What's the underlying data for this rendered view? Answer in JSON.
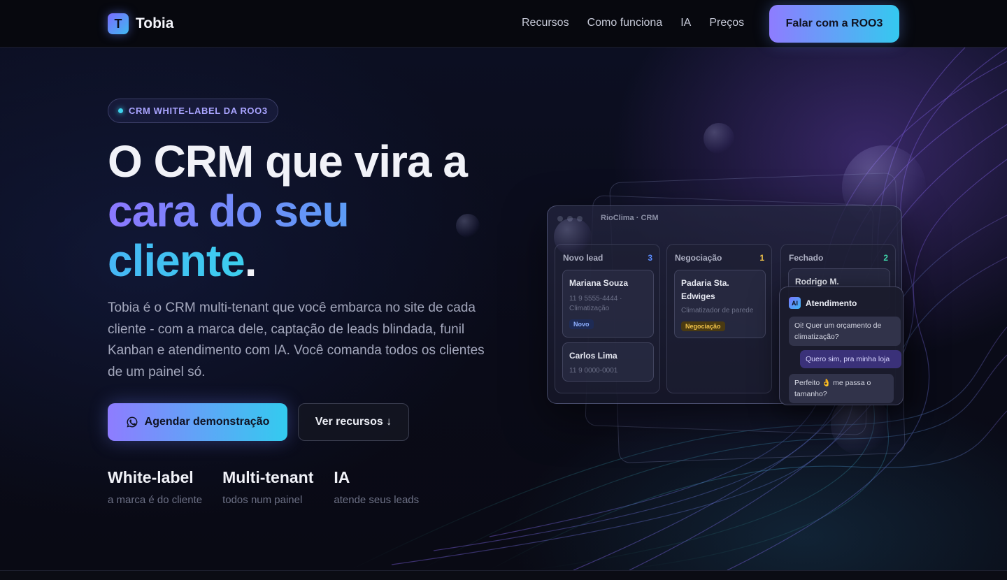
{
  "brand": {
    "logo_letter": "T",
    "name": "Tobia"
  },
  "nav": {
    "links": [
      "Recursos",
      "Como funciona",
      "IA",
      "Preços"
    ],
    "cta_label": "Falar com a ROO3"
  },
  "hero": {
    "badge": "CRM WHITE-LABEL DA ROO3",
    "headline_line1": "O CRM que vira a",
    "headline_line2": "cara do seu",
    "headline_line3": "cliente",
    "headline_period": ".",
    "description": "Tobia é o CRM multi-tenant que você embarca no site de cada cliente - com a marca dele, captação de leads blindada, funil Kanban e atendimento com IA. Você comanda todos os clientes de um painel só.",
    "primary_button": "Agendar demonstração",
    "secondary_button": "Ver recursos ↓",
    "stats": [
      {
        "title": "White-label",
        "subtitle": "a marca é do cliente"
      },
      {
        "title": "Multi-tenant",
        "subtitle": "todos num painel"
      },
      {
        "title": "IA",
        "subtitle": "atende seus leads"
      }
    ]
  },
  "mockup": {
    "window_title": "RioClima · CRM",
    "columns": [
      {
        "title": "Novo lead",
        "count": "3",
        "count_color": "#5b8cff",
        "cards": [
          {
            "name": "Mariana Souza",
            "phone": "11 9 5555-4444 ·",
            "detail": "Climatização",
            "tag": "Novo"
          },
          {
            "name": "Carlos Lima",
            "phone": "11 9 0000-0001",
            "detail": "",
            "tag": ""
          }
        ]
      },
      {
        "title": "Negociação",
        "count": "1",
        "count_color": "#f0c24a",
        "cards": [
          {
            "name": "Padaria Sta. Edwiges",
            "phone": "",
            "detail": "Climatizador de parede",
            "tag": "Negociação"
          }
        ]
      },
      {
        "title": "Fechado",
        "count": "2",
        "count_color": "#3fd4a8",
        "cards": [
          {
            "name": "Rodrigo M.",
            "phone": "",
            "detail": "",
            "tag": ""
          }
        ]
      }
    ],
    "chat": {
      "badge": "AI",
      "title": "Atendimento",
      "messages": [
        {
          "from": "bot",
          "text": "Oi! Quer um orçamento de climatização?"
        },
        {
          "from": "user",
          "text": "Quero sim, pra minha loja"
        },
        {
          "from": "bot",
          "text": "Perfeito 👌 me passa o tamanho?"
        }
      ]
    }
  },
  "colors": {
    "accent_start": "#8e7cff",
    "accent_end": "#33cbef",
    "background": "#0a0b14"
  }
}
